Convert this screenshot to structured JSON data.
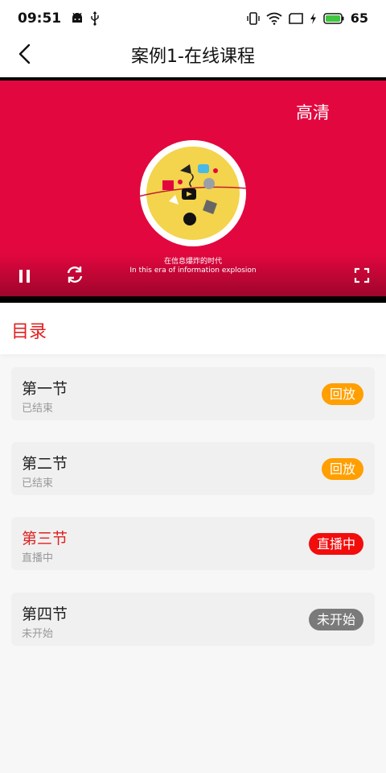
{
  "status_bar": {
    "time": "09:51",
    "battery_level": "65",
    "battery_color": "#3ec63e"
  },
  "header": {
    "title": "案例1-在线课程",
    "back_icon": "chevron-left-icon"
  },
  "video": {
    "quality_label": "高清",
    "background_color": "#e3073f",
    "subtitle_cn": "在信息爆炸的时代",
    "subtitle_en": "In this era of information explosion"
  },
  "catalog": {
    "title": "目录",
    "accent_color": "#e02020",
    "lessons": [
      {
        "title": "第一节",
        "status": "已结束",
        "badge": "回放",
        "badge_color": "#ff9f00",
        "active": false
      },
      {
        "title": "第二节",
        "status": "已结束",
        "badge": "回放",
        "badge_color": "#ff9f00",
        "active": false
      },
      {
        "title": "第三节",
        "status": "直播中",
        "badge": "直播中",
        "badge_color": "#f20d0d",
        "active": true
      },
      {
        "title": "第四节",
        "status": "未开始",
        "badge": "未开始",
        "badge_color": "#7a7a7a",
        "active": false
      }
    ]
  }
}
